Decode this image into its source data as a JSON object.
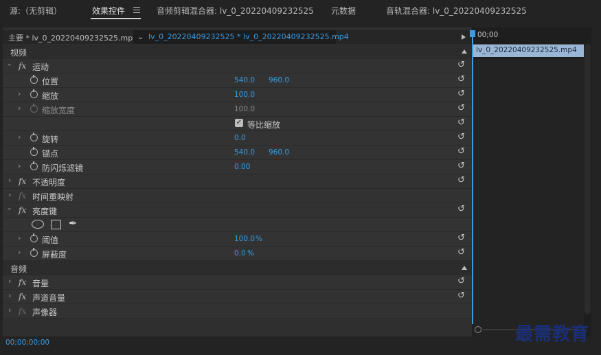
{
  "tabs": [
    {
      "label": "源:（无剪辑）"
    },
    {
      "label": "效果控件"
    },
    {
      "label": "音频剪辑混合器: lv_0_20220409232525"
    },
    {
      "label": "元数据"
    },
    {
      "label": "音轨混合器: lv_0_20220409232525"
    }
  ],
  "header": {
    "master": "主要 * lv_0_20220409232525.mp4",
    "sequence": "lv_0_20220409232525 * lv_0_20220409232525.mp4"
  },
  "sections": {
    "video": "视频",
    "audio": "音频"
  },
  "motion": {
    "label": "运动",
    "position": {
      "label": "位置",
      "x": "540.0",
      "y": "960.0"
    },
    "scale": {
      "label": "缩放",
      "value": "100.0"
    },
    "scale_width": {
      "label": "缩放宽度",
      "value": "100.0"
    },
    "uniform_scale": {
      "label": "等比缩放",
      "checked": true
    },
    "rotation": {
      "label": "旋转",
      "value": "0.0"
    },
    "anchor": {
      "label": "锚点",
      "x": "540.0",
      "y": "960.0"
    },
    "anti_flicker": {
      "label": "防闪烁滤镜",
      "value": "0.00"
    }
  },
  "opacity": {
    "label": "不透明度"
  },
  "time_remap": {
    "label": "时间重映射"
  },
  "luma_key": {
    "label": "亮度键",
    "threshold": {
      "label": "阈值",
      "value": "100.0",
      "unit": "%"
    },
    "cutoff": {
      "label": "屏蔽度",
      "value": "0.0",
      "unit": "%"
    }
  },
  "audio": {
    "volume": {
      "label": "音量"
    },
    "channel_volume": {
      "label": "声道音量"
    },
    "panner": {
      "label": "声像器"
    }
  },
  "timeline": {
    "timecode": "00;00",
    "clip_name": "lv_0_20220409232525.mp4"
  },
  "status": {
    "timecode": "00;00;00;00"
  },
  "watermark": "最需教育",
  "icons": {
    "fx": "fx",
    "reset": "↺",
    "pen": "✒"
  },
  "colors": {
    "accent": "#3d9be0",
    "clip": "#9ab6d6",
    "watermark": "#1a2f78"
  }
}
